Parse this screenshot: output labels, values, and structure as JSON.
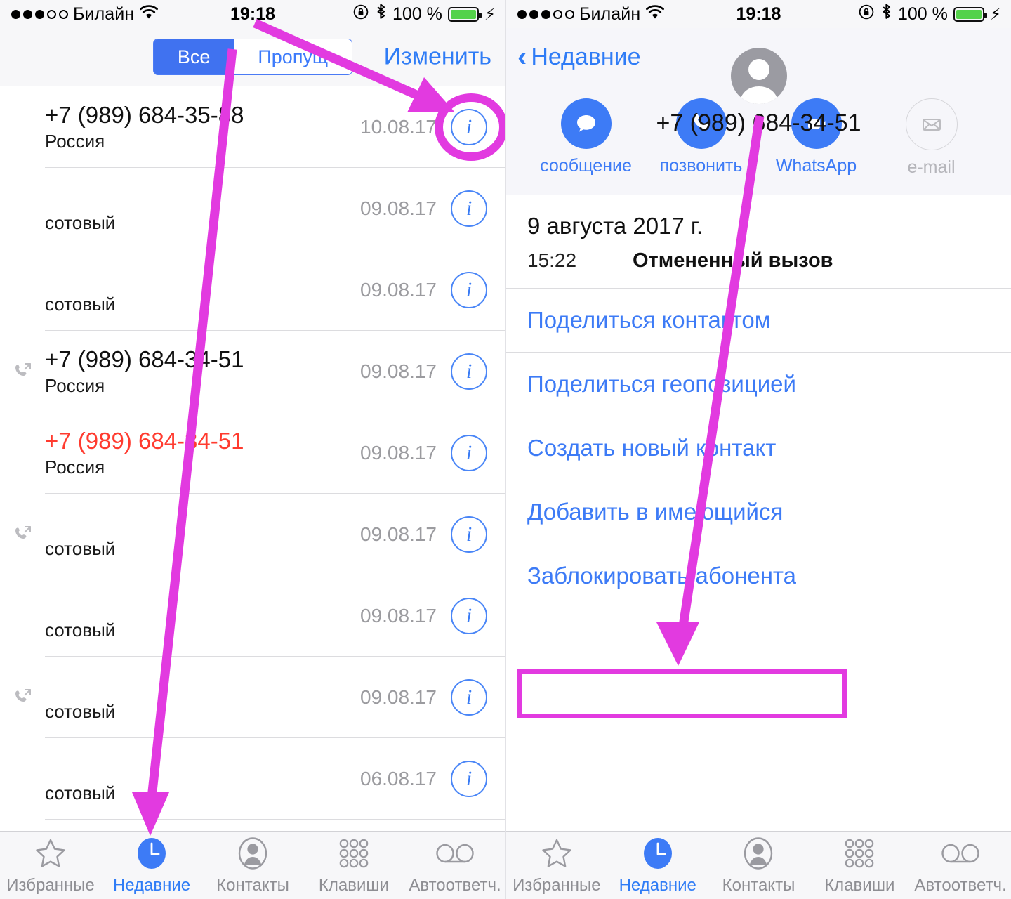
{
  "accent": {
    "ios_blue": "#3d7bf6",
    "annotation_pink": "#e23ae0",
    "missed_red": "#ff3b2f",
    "battery_green": "#54d24a"
  },
  "status_bar": {
    "signal_dots_filled": 3,
    "signal_dots_total": 5,
    "carrier": "Билайн",
    "wifi_icon": "wifi-icon",
    "time": "19:18",
    "rotation_lock_icon": "rotation-lock-icon",
    "bluetooth_icon": "bluetooth-icon",
    "battery_percent": "100 %",
    "battery_icon": "battery-icon",
    "charging_icon": "lightning-bolt-icon"
  },
  "left_screen": {
    "segmented_control": {
      "options": [
        "Все",
        "Пропущенные"
      ],
      "selected": "Все",
      "visible_labels": [
        "Все",
        "Пропущ"
      ]
    },
    "edit_label": "Изменить",
    "calls": [
      {
        "name": "+7 (989) 684-35-88",
        "sub": "Россия",
        "date": "10.08.17",
        "missed": false,
        "outgoing": false,
        "redacted": false
      },
      {
        "name": "",
        "sub": "сотовый",
        "date": "09.08.17",
        "missed": false,
        "outgoing": false,
        "redacted": true
      },
      {
        "name": "",
        "sub": "сотовый",
        "date": "09.08.17",
        "missed": false,
        "outgoing": false,
        "redacted": true
      },
      {
        "name": "+7 (989) 684-34-51",
        "sub": "Россия",
        "date": "09.08.17",
        "missed": false,
        "outgoing": true,
        "redacted": false
      },
      {
        "name": "+7 (989) 684-34-51",
        "sub": "Россия",
        "date": "09.08.17",
        "missed": true,
        "outgoing": false,
        "redacted": false
      },
      {
        "name": "",
        "sub": "сотовый",
        "date": "09.08.17",
        "missed": false,
        "outgoing": true,
        "redacted": true
      },
      {
        "name": "",
        "sub": "сотовый",
        "date": "09.08.17",
        "missed": false,
        "outgoing": false,
        "redacted": true
      },
      {
        "name": "",
        "sub": "сотовый",
        "date": "09.08.17",
        "missed": false,
        "outgoing": true,
        "redacted": true
      },
      {
        "name": "",
        "sub": "сотовый",
        "date": "06.08.17",
        "missed": false,
        "outgoing": false,
        "redacted": true
      }
    ]
  },
  "right_screen": {
    "back_label": "Недавние",
    "avatar_icon": "person-placeholder-avatar",
    "phone_number": "+7 (989) 684-34-51",
    "actions": [
      {
        "label": "сообщение",
        "icon": "message-bubble-icon",
        "disabled": false
      },
      {
        "label": "позвонить",
        "icon": "phone-handset-icon",
        "disabled": false
      },
      {
        "label": "WhatsApp",
        "icon": "video-camera-icon",
        "disabled": false
      },
      {
        "label": "e-mail",
        "icon": "envelope-icon",
        "disabled": true
      }
    ],
    "history_date": "9 августа 2017 г.",
    "history_time": "15:22",
    "history_type": "Отмененный вызов",
    "links": [
      "Поделиться контактом",
      "Поделиться геопозицией",
      "Создать новый контакт",
      "Добавить в имеющийся",
      "Заблокировать абонента"
    ],
    "highlighted_link": "Заблокировать абонента"
  },
  "tab_bar": {
    "tabs": [
      {
        "label": "Избранные",
        "icon": "star-icon",
        "active": false
      },
      {
        "label": "Недавние",
        "icon": "clock-icon",
        "active": true
      },
      {
        "label": "Контакты",
        "icon": "person-icon",
        "active": false
      },
      {
        "label": "Клавиши",
        "icon": "keypad-icon",
        "active": false
      },
      {
        "label": "Автоответч.",
        "icon": "voicemail-icon",
        "active": false
      }
    ]
  },
  "annotations": {
    "arrow_1": "arrow from segmented-control down to Недавние tab",
    "arrow_2": "arrow from top toolbar to info button of first call row",
    "arrow_3": "arrow from phone number down to Заблокировать абонента",
    "circle_1": "circle highlighting info button on first call row",
    "box_1": "box highlighting Заблокировать абонента row"
  }
}
